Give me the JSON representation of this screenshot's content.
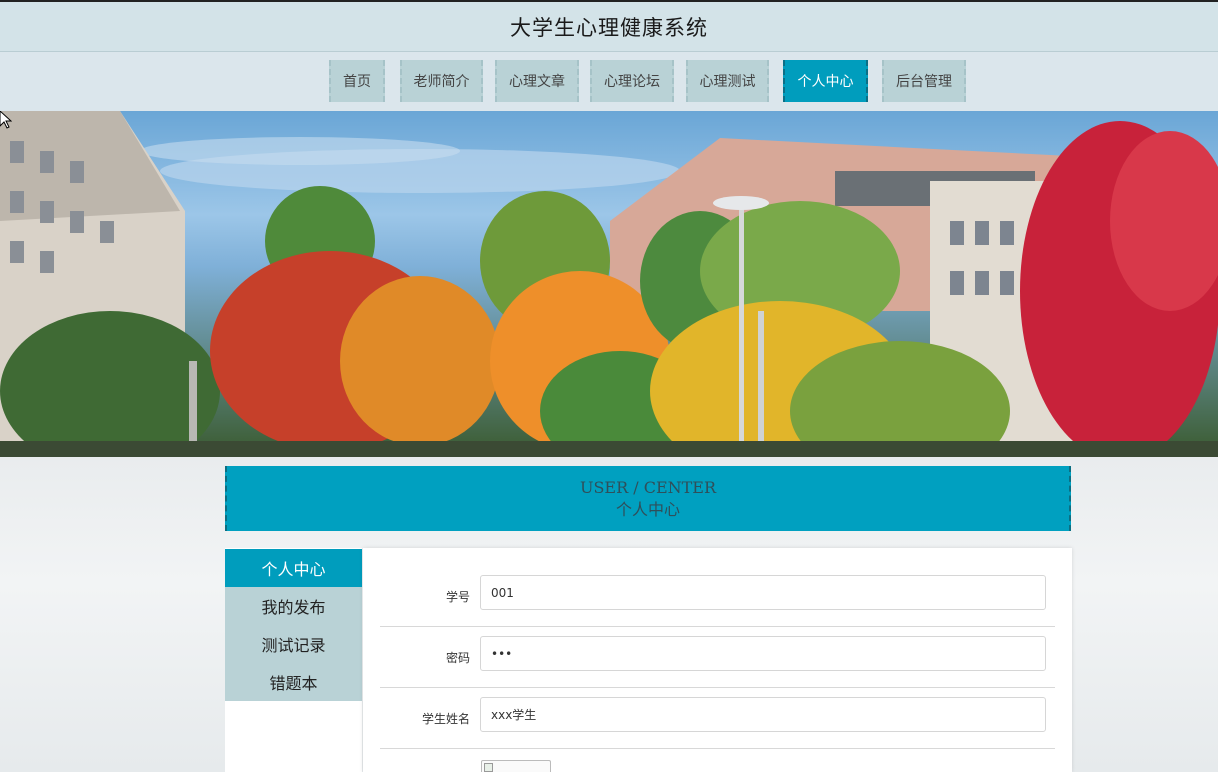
{
  "header": {
    "title": "大学生心理健康系统"
  },
  "nav": {
    "items": [
      {
        "label": "首页",
        "active": false
      },
      {
        "label": "老师简介",
        "active": false
      },
      {
        "label": "心理文章",
        "active": false
      },
      {
        "label": "心理论坛",
        "active": false
      },
      {
        "label": "心理测试",
        "active": false
      },
      {
        "label": "个人中心",
        "active": true
      },
      {
        "label": "后台管理",
        "active": false
      }
    ]
  },
  "section": {
    "title_en": "USER / CENTER",
    "title_cn": "个人中心"
  },
  "sidebar": {
    "items": [
      {
        "label": "个人中心",
        "active": true
      },
      {
        "label": "我的发布",
        "active": false
      },
      {
        "label": "测试记录",
        "active": false
      },
      {
        "label": "错题本",
        "active": false
      }
    ]
  },
  "form": {
    "student_id": {
      "label": "学号",
      "value": "001"
    },
    "password": {
      "label": "密码",
      "value": "•••"
    },
    "student_name": {
      "label": "学生姓名",
      "value": "xxx学生"
    }
  },
  "colors": {
    "accent": "#009dbd",
    "nav_inactive": "#b9d2d6",
    "title_bar": "#d3e3e8"
  }
}
